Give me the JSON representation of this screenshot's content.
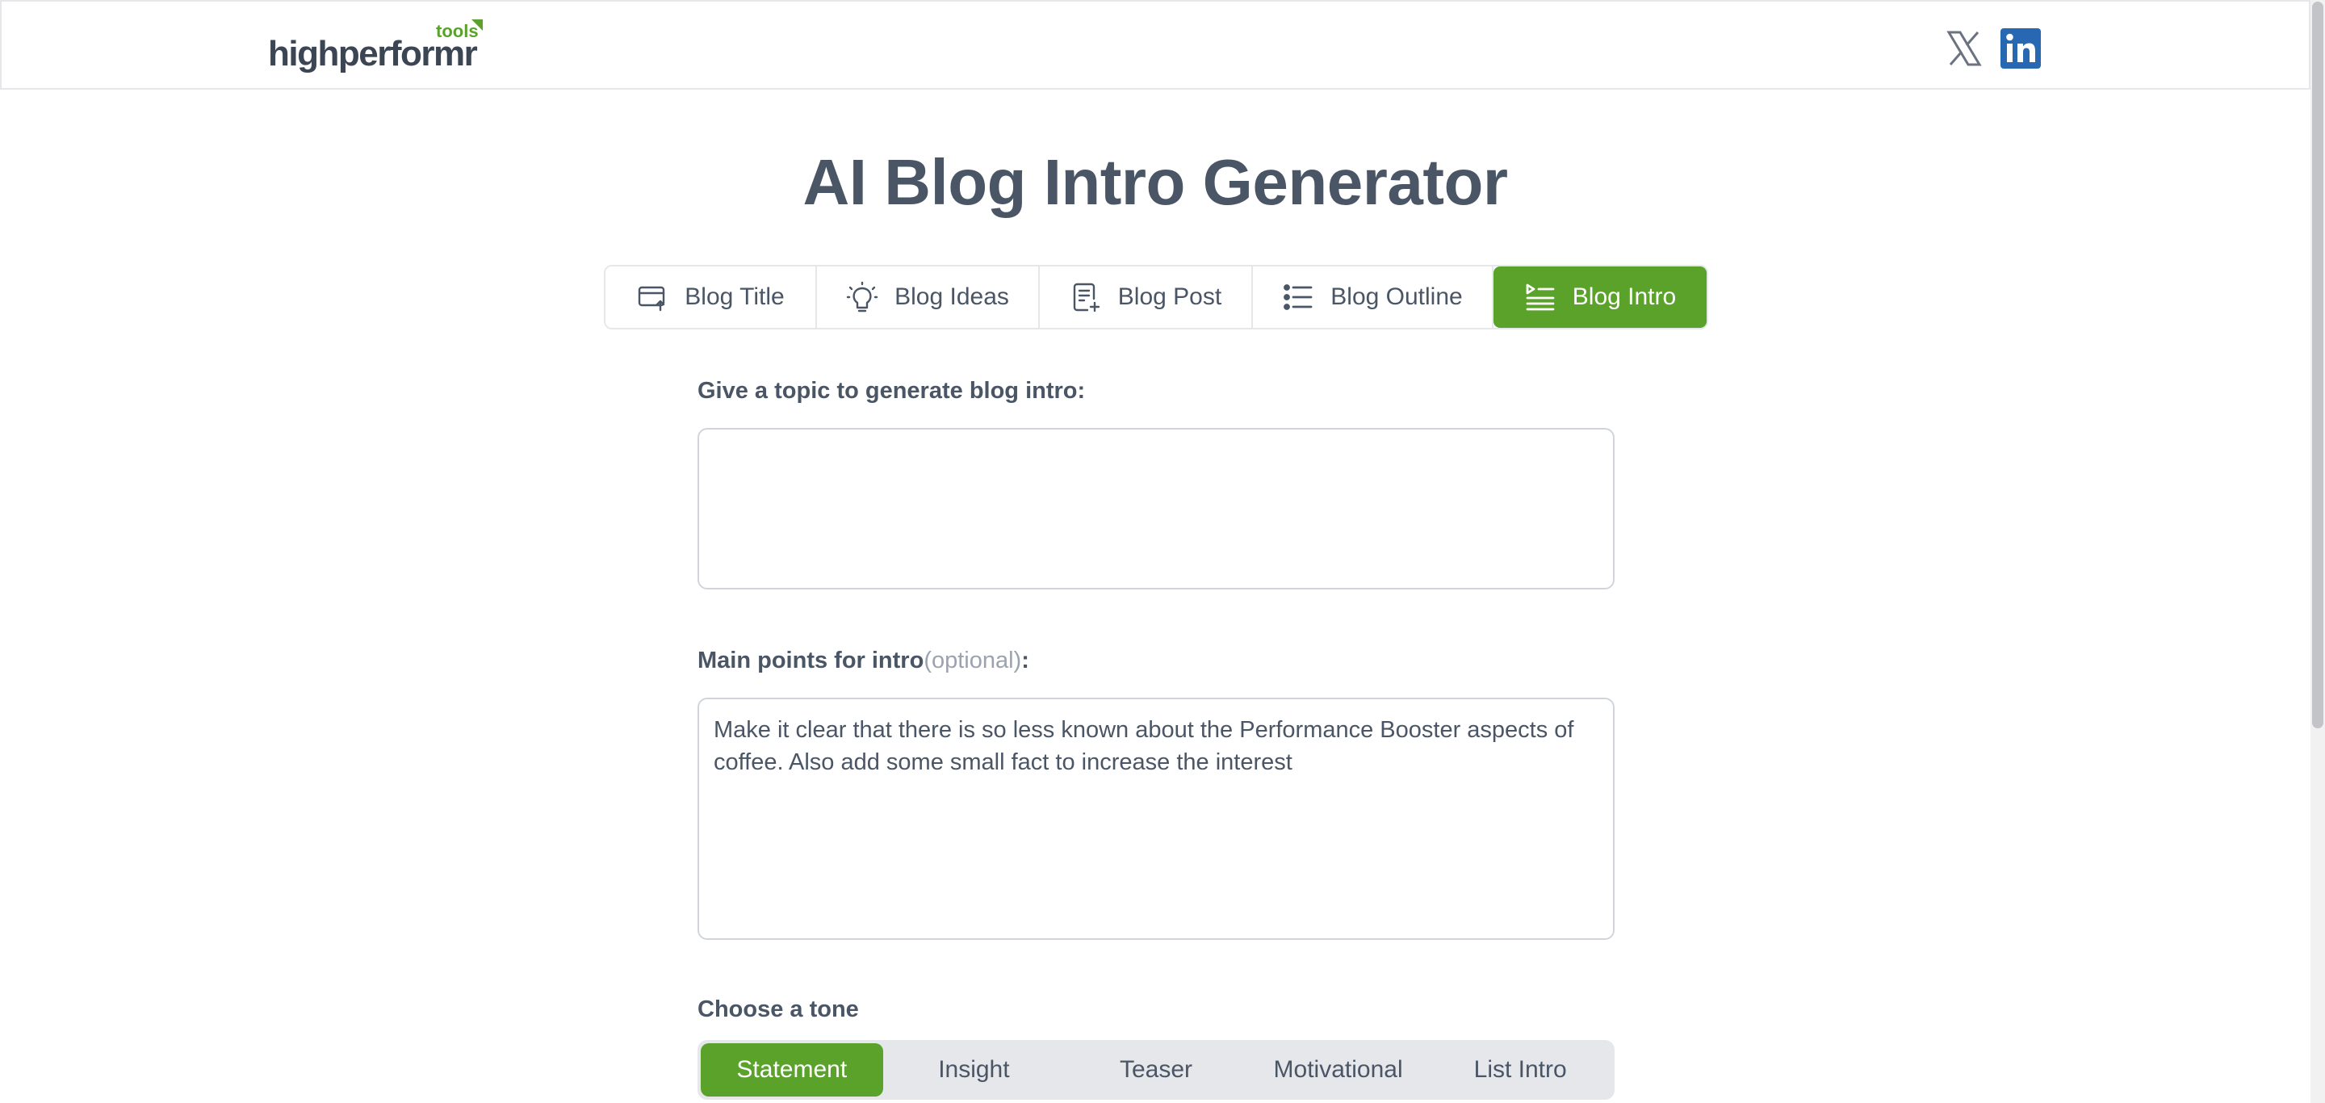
{
  "header": {
    "logo_text": "highperformr",
    "logo_badge": "tools",
    "social": [
      "x-icon",
      "linkedin-icon"
    ]
  },
  "page": {
    "title": "AI Blog Intro Generator"
  },
  "tabs": [
    {
      "label": "Blog Title",
      "icon": "card-upload-icon",
      "active": false
    },
    {
      "label": "Blog Ideas",
      "icon": "lightbulb-icon",
      "active": false
    },
    {
      "label": "Blog Post",
      "icon": "document-plus-icon",
      "active": false
    },
    {
      "label": "Blog Outline",
      "icon": "list-icon",
      "active": false
    },
    {
      "label": "Blog Intro",
      "icon": "list-play-icon",
      "active": true
    }
  ],
  "form": {
    "topic_label": "Give a topic to generate blog intro:",
    "topic_value": "",
    "points_label": "Main points for intro",
    "points_optional": "(optional)",
    "points_colon": ":",
    "points_value": "Make it clear that there is so less known about the Performance Booster aspects of coffee. Also add some small fact to increase the interest",
    "tone_label": "Choose a tone",
    "tones": [
      "Statement",
      "Insight",
      "Teaser",
      "Motivational",
      "List Intro"
    ],
    "selected_tone": "Statement"
  },
  "colors": {
    "accent": "#5aa22a",
    "text": "#4a5565",
    "border": "#e5e7eb",
    "linkedin": "#2867b2"
  }
}
